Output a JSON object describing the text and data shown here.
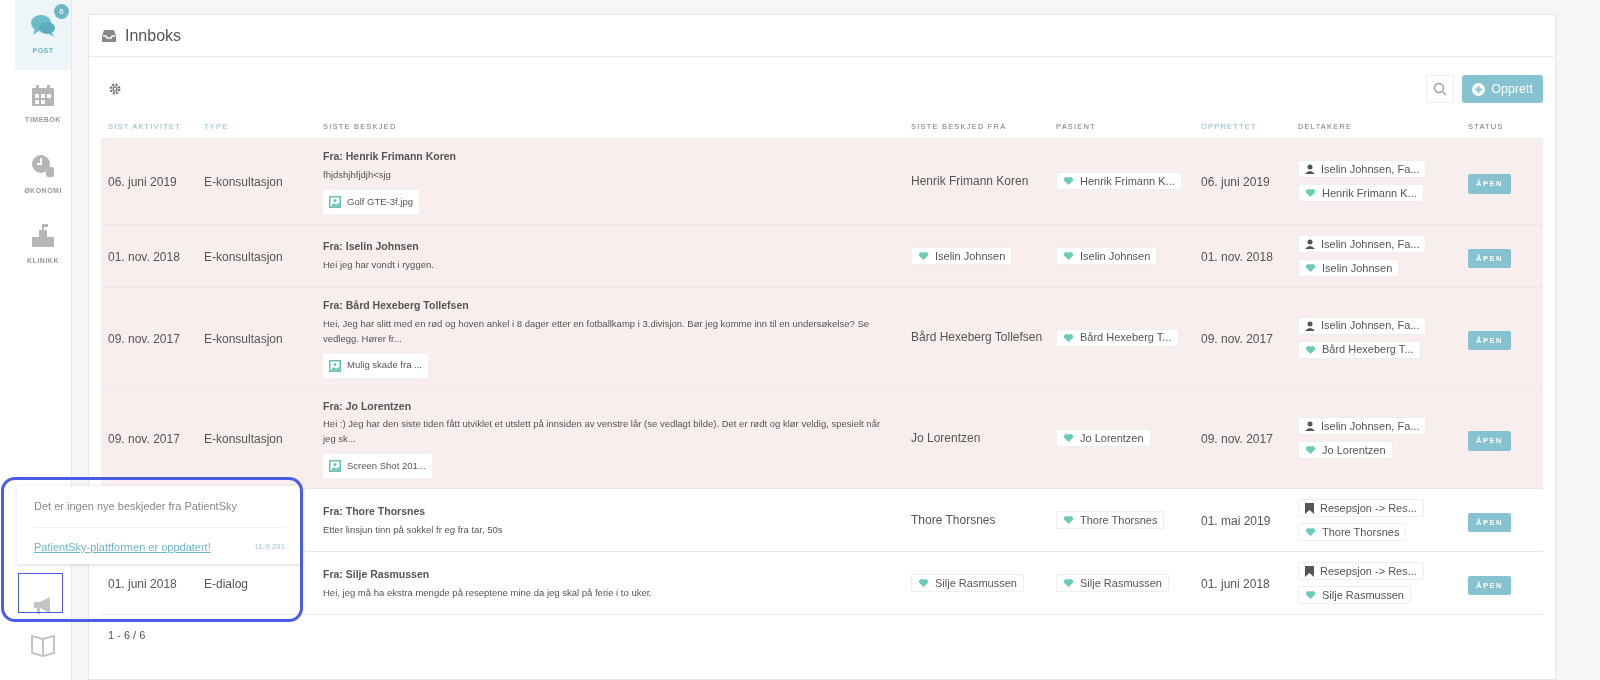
{
  "sidebar": {
    "items": [
      {
        "label": "POST",
        "selected": true,
        "badge": "6"
      },
      {
        "label": "TIMEBOK",
        "selected": false
      },
      {
        "label": "ØKONOMI",
        "selected": false
      },
      {
        "label": "KLINIKK",
        "selected": false
      }
    ]
  },
  "inbox": {
    "title": "Innboks",
    "create_button": "Opprett",
    "columns": [
      {
        "label": "SIST AKTIVITET",
        "sortable": true
      },
      {
        "label": "TYPE",
        "sortable": true
      },
      {
        "label": "SISTE BESKJED",
        "sortable": false
      },
      {
        "label": "SISTE BESKJED FRA",
        "sortable": false
      },
      {
        "label": "PASIENT",
        "sortable": false
      },
      {
        "label": "OPPRETTET",
        "sortable": true
      },
      {
        "label": "DELTAKERE",
        "sortable": false
      },
      {
        "label": "STATUS",
        "sortable": false
      }
    ],
    "rows": [
      {
        "unread": true,
        "last_activity": "06. juni 2019",
        "type": "E-konsultasjon",
        "from_title": "Fra: Henrik Frimann Koren",
        "message": "fhjdshjhfjdjh<sjg",
        "attachment": "Golf GTE-3f.jpg",
        "sender": {
          "kind": "text",
          "name": "Henrik Frimann Koren"
        },
        "patient": "Henrik Frimann K...",
        "created": "06. juni 2019",
        "participants": [
          {
            "kind": "person",
            "name": "Iselin Johnsen, Fa..."
          },
          {
            "kind": "patient",
            "name": "Henrik Frimann K..."
          }
        ],
        "status": "ÅPEN"
      },
      {
        "unread": true,
        "last_activity": "01. nov. 2018",
        "type": "E-konsultasjon",
        "from_title": "Fra: Iselin Johnsen",
        "message": "Hei jeg har vondt i ryggen.",
        "sender": {
          "kind": "patient",
          "name": "Iselin Johnsen"
        },
        "patient": "Iselin Johnsen",
        "created": "01. nov. 2018",
        "participants": [
          {
            "kind": "person",
            "name": "Iselin Johnsen, Fa..."
          },
          {
            "kind": "patient",
            "name": "Iselin Johnsen"
          }
        ],
        "status": "ÅPEN"
      },
      {
        "unread": true,
        "last_activity": "09. nov. 2017",
        "type": "E-konsultasjon",
        "from_title": "Fra: Bård Hexeberg Tollefsen",
        "message": "Hei, Jeg har slitt med en rød og hoven ankel i 8 dager etter en fotballkamp i 3.divisjon. Bør jeg komme inn til en undersøkelse? Se vedlegg. Hører fr...",
        "attachment": "Mulig skade fra ...",
        "sender": {
          "kind": "text",
          "name": "Bård Hexeberg Tollefsen"
        },
        "patient": "Bård Hexeberg T...",
        "created": "09. nov. 2017",
        "participants": [
          {
            "kind": "person",
            "name": "Iselin Johnsen, Fa..."
          },
          {
            "kind": "patient",
            "name": "Bård Hexeberg T..."
          }
        ],
        "status": "ÅPEN"
      },
      {
        "unread": true,
        "last_activity": "09. nov. 2017",
        "type": "E-konsultasjon",
        "from_title": "Fra: Jo Lorentzen",
        "message": "Hei :) Jeg har den siste tiden fått utviklet et utslett på innsiden av venstre lår (se vedlagt bilde). Det er rødt og klør veldig, spesielt når jeg sk...",
        "attachment": "Screen Shot 201...",
        "sender": {
          "kind": "text",
          "name": "Jo Lorentzen"
        },
        "patient": "Jo Lorentzen",
        "created": "09. nov. 2017",
        "participants": [
          {
            "kind": "person",
            "name": "Iselin Johnsen, Fa..."
          },
          {
            "kind": "patient",
            "name": "Jo Lorentzen"
          }
        ],
        "status": "ÅPEN"
      },
      {
        "unread": false,
        "from_title": "Fra: Thore Thorsnes",
        "message": "Etter linsjun tinn på sokkel fr eg fra tar, 50s",
        "sender": {
          "kind": "text",
          "name": "Thore Thorsnes"
        },
        "patient": "Thore Thorsnes",
        "created": "01. mai 2019",
        "participants": [
          {
            "kind": "bookmark",
            "name": "Resepsjon -> Res..."
          },
          {
            "kind": "patient",
            "name": "Thore Thorsnes"
          }
        ],
        "status": "ÅPEN"
      },
      {
        "unread": false,
        "last_activity": "01. juni 2018",
        "type": "E-dialog",
        "from_title": "Fra: Silje Rasmussen",
        "message": "Hei, jeg må ha ekstra mengde på reseptene mine da jeg skal på ferie i to uker.",
        "sender": {
          "kind": "patient",
          "name": "Silje Rasmussen"
        },
        "patient": "Silje Rasmussen",
        "created": "01. juni 2018",
        "participants": [
          {
            "kind": "bookmark",
            "name": "Resepsjon -> Res..."
          },
          {
            "kind": "patient",
            "name": "Silje Rasmussen"
          }
        ],
        "status": "ÅPEN"
      }
    ],
    "pagination": "1 - 6 / 6"
  },
  "news_popup": {
    "message": "Det er ingen nye beskjeder fra PatientSky",
    "link": "PatientSky-plattformen er oppdatert!",
    "date": "11.9.201"
  }
}
